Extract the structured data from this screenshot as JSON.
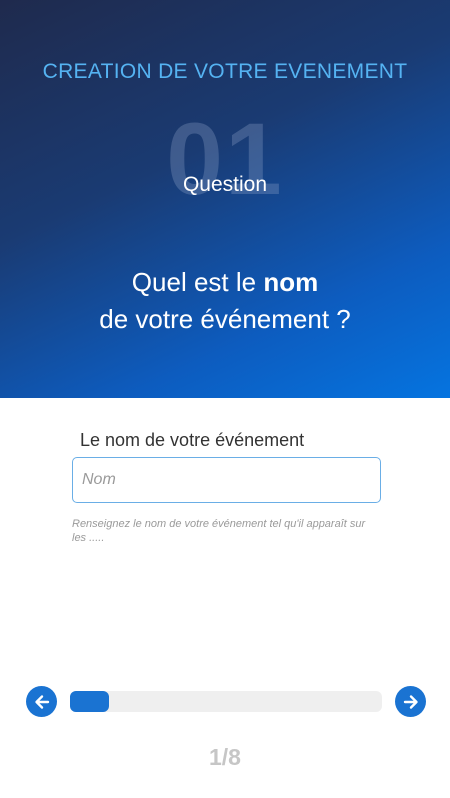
{
  "header": {
    "title": "CREATION DE VOTRE EVENEMENT",
    "step_number": "01",
    "step_label": "Question",
    "question_prefix": "Quel est le ",
    "question_bold": "nom",
    "question_suffix": "de votre événement ?"
  },
  "form": {
    "label": "Le nom de votre événement",
    "value": "",
    "placeholder": "Nom",
    "helper": "Renseignez le nom de votre événement tel qu'il apparaît sur les ....."
  },
  "navigation": {
    "prev_icon": "arrow-left-icon",
    "next_icon": "arrow-right-icon",
    "progress_fraction": 0.125,
    "page_counter": "1/8"
  },
  "colors": {
    "accent": "#1a73d2",
    "title": "#55b3f2",
    "gradient_start": "#1f2a4d",
    "gradient_end": "#0574e0"
  }
}
